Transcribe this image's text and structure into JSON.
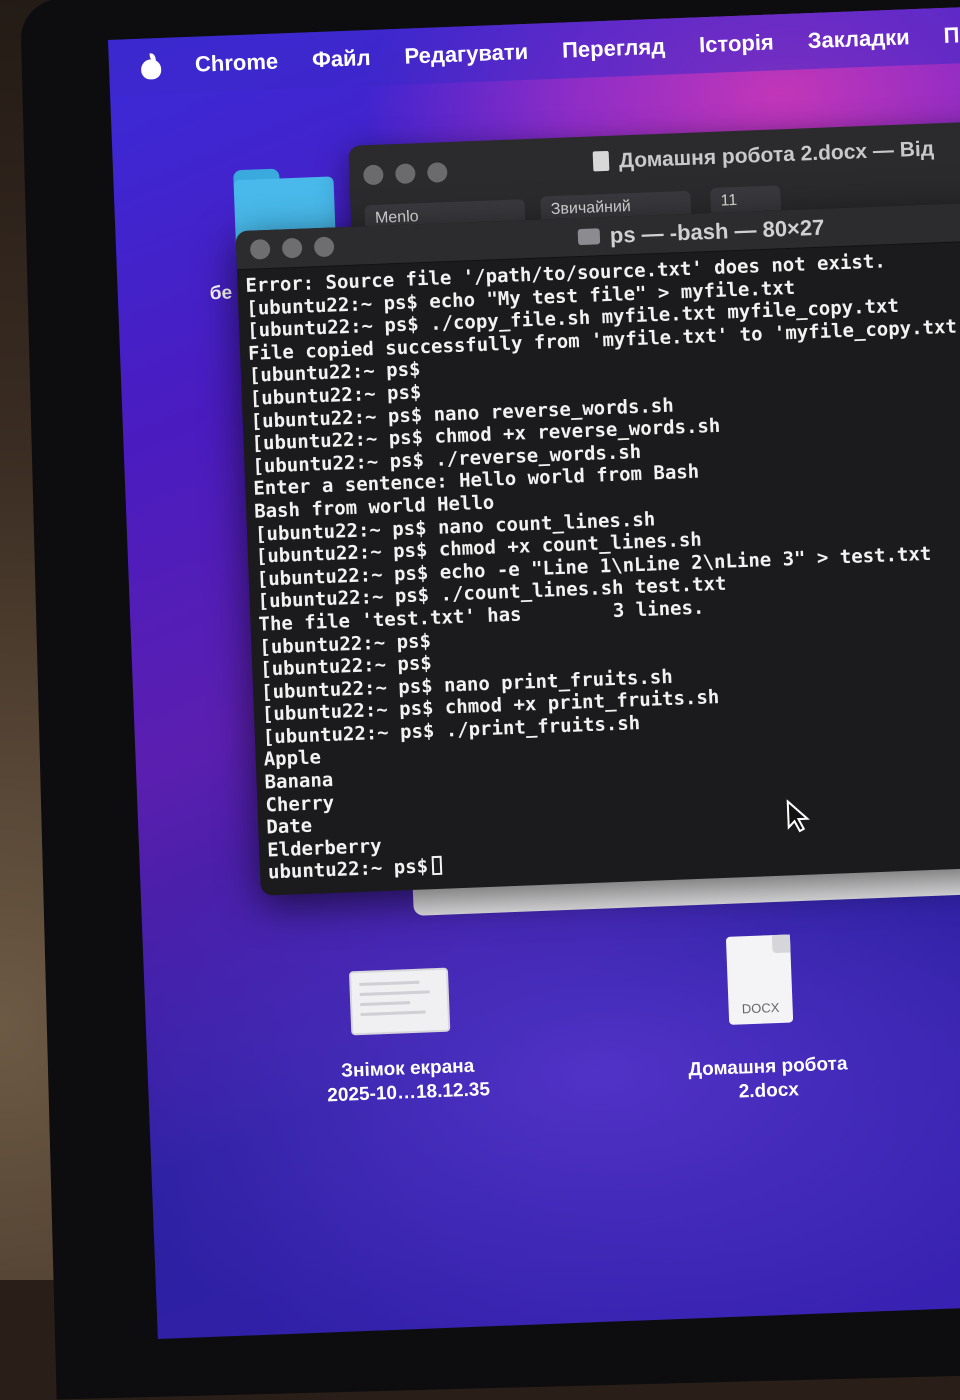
{
  "menubar": {
    "app_name": "Chrome",
    "items": [
      "Файл",
      "Редагувати",
      "Перегляд",
      "Історія",
      "Закладки",
      "Пр"
    ]
  },
  "desktop": {
    "folder_label": "бе",
    "files": [
      {
        "icon": "screenshot-icon",
        "label_line1": "Знімок екрана",
        "label_line2": "2025-10…18.12.35"
      },
      {
        "icon": "docx-file-icon",
        "ext": "DOCX",
        "label_line1": "Домашня робота",
        "label_line2": "2.docx"
      }
    ]
  },
  "pages_window": {
    "title": "Домашня робота 2.docx — Від",
    "font": "Menlo",
    "style": "Звичайний",
    "size": "11"
  },
  "terminal": {
    "title": "ps — -bash — 80×27",
    "lines": [
      "Error: Source file '/path/to/source.txt' does not exist.",
      "[ubuntu22:~ ps$ echo \"My test file\" > myfile.txt",
      "[ubuntu22:~ ps$ ./copy_file.sh myfile.txt myfile_copy.txt",
      "File copied successfully from 'myfile.txt' to 'myfile_copy.txt",
      "[ubuntu22:~ ps$",
      "[ubuntu22:~ ps$",
      "[ubuntu22:~ ps$ nano reverse_words.sh",
      "[ubuntu22:~ ps$ chmod +x reverse_words.sh",
      "[ubuntu22:~ ps$ ./reverse_words.sh",
      "Enter a sentence: Hello world from Bash",
      "Bash from world Hello",
      "[ubuntu22:~ ps$ nano count_lines.sh",
      "[ubuntu22:~ ps$ chmod +x count_lines.sh",
      "[ubuntu22:~ ps$ echo -e \"Line 1\\nLine 2\\nLine 3\" > test.txt",
      "[ubuntu22:~ ps$ ./count_lines.sh test.txt",
      "The file 'test.txt' has        3 lines.",
      "[ubuntu22:~ ps$",
      "[ubuntu22:~ ps$",
      "[ubuntu22:~ ps$ nano print_fruits.sh",
      "[ubuntu22:~ ps$ chmod +x print_fruits.sh",
      "[ubuntu22:~ ps$ ./print_fruits.sh",
      "Apple",
      "Banana",
      "Cherry",
      "Date",
      "Elderberry"
    ],
    "prompt": "ubuntu22:~ ps$"
  }
}
